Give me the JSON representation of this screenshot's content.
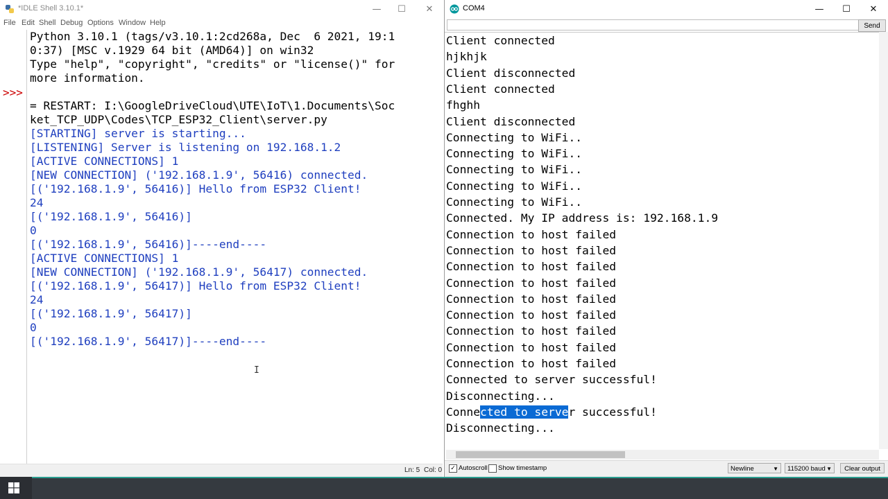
{
  "idle": {
    "title": "*IDLE Shell 3.10.1*",
    "menu": [
      "File",
      "Edit",
      "Shell",
      "Debug",
      "Options",
      "Window",
      "Help"
    ],
    "prompt": ">>>",
    "lines": [
      {
        "text": "Python 3.10.1 (tags/v3.10.1:2cd268a, Dec  6 2021, 19:1",
        "color": "black"
      },
      {
        "text": "0:37) [MSC v.1929 64 bit (AMD64)] on win32",
        "color": "black"
      },
      {
        "text": "Type \"help\", \"copyright\", \"credits\" or \"license()\" for",
        "color": "black"
      },
      {
        "text": "more information.",
        "color": "black"
      },
      {
        "text": "",
        "color": "black"
      },
      {
        "text": "= RESTART: I:\\GoogleDriveCloud\\UTE\\IoT\\1.Documents\\Soc",
        "color": "black"
      },
      {
        "text": "ket_TCP_UDP\\Codes\\TCP_ESP32_Client\\server.py",
        "color": "black"
      },
      {
        "text": "[STARTING] server is starting...",
        "color": "blue"
      },
      {
        "text": "[LISTENING] Server is listening on 192.168.1.2",
        "color": "blue"
      },
      {
        "text": "[ACTIVE CONNECTIONS] 1",
        "color": "blue"
      },
      {
        "text": "[NEW CONNECTION] ('192.168.1.9', 56416) connected.",
        "color": "blue"
      },
      {
        "text": "[('192.168.1.9', 56416)] Hello from ESP32 Client!",
        "color": "blue"
      },
      {
        "text": "24",
        "color": "blue"
      },
      {
        "text": "[('192.168.1.9', 56416)]",
        "color": "blue"
      },
      {
        "text": "0",
        "color": "blue"
      },
      {
        "text": "[('192.168.1.9', 56416)]----end----",
        "color": "blue"
      },
      {
        "text": "[ACTIVE CONNECTIONS] 1",
        "color": "blue"
      },
      {
        "text": "[NEW CONNECTION] ('192.168.1.9', 56417) connected.",
        "color": "blue"
      },
      {
        "text": "[('192.168.1.9', 56417)] Hello from ESP32 Client!",
        "color": "blue"
      },
      {
        "text": "24",
        "color": "blue"
      },
      {
        "text": "[('192.168.1.9', 56417)]",
        "color": "blue"
      },
      {
        "text": "0",
        "color": "blue"
      },
      {
        "text": "[('192.168.1.9', 56417)]----end----",
        "color": "blue"
      }
    ],
    "status_ln": "Ln: 5",
    "status_col": "Col: 0"
  },
  "serial_monitor": {
    "title": "COM4",
    "send_label": "Send",
    "input_value": "",
    "lines": [
      "Client connected",
      "hjkhjk",
      "Client disconnected",
      "Client connected",
      "fhghh",
      "Client disconnected",
      "Connecting to WiFi..",
      "Connecting to WiFi..",
      "Connecting to WiFi..",
      "Connecting to WiFi..",
      "Connecting to WiFi..",
      "Connected. My IP address is: 192.168.1.9",
      "Connection to host failed",
      "Connection to host failed",
      "Connection to host failed",
      "Connection to host failed",
      "Connection to host failed",
      "Connection to host failed",
      "Connection to host failed",
      "Connection to host failed",
      "Connection to host failed",
      "Connected to server successful!",
      "Disconnecting..."
    ],
    "selected_line": {
      "before": "Conne",
      "selected": "cted to serve",
      "after": "r successful!"
    },
    "last_line": "Disconnecting...",
    "autoscroll_label": "Autoscroll",
    "autoscroll_checked": true,
    "timestamp_label": "Show timestamp",
    "timestamp_checked": false,
    "line_ending": "Newline",
    "baud_rate": "115200 baud",
    "clear_label": "Clear output"
  },
  "colors": {
    "idle_output_blue": "#1f3fbf",
    "prompt_red": "#cc0000",
    "selection_blue": "#0a6ad4",
    "taskbar": "#2b2e33"
  }
}
